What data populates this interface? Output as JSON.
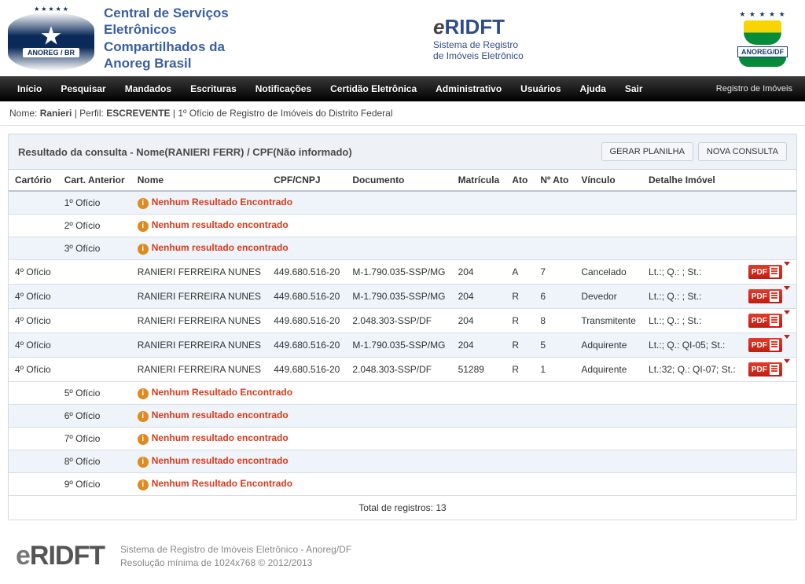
{
  "header": {
    "central_title_l1": "Central de Serviços",
    "central_title_l2": "Eletrônicos",
    "central_title_l3": "Compartilhados da",
    "central_title_l4": "Anoreg Brasil",
    "anoreg_br_band": "ANOREG / BR",
    "eridft_brand_e": "e",
    "eridft_brand_rest": "RIDFT",
    "eridft_sub1": "Sistema de Registro",
    "eridft_sub2": "de Imóveis Eletrônico",
    "anoreg_df_band": "ANOREG/DF"
  },
  "nav": {
    "inicio": "Início",
    "pesquisar": "Pesquisar",
    "mandados": "Mandados",
    "escrituras": "Escrituras",
    "notificacoes": "Notificações",
    "certidao": "Certidão Eletrônica",
    "administrativo": "Administrativo",
    "usuarios": "Usuários",
    "ajuda": "Ajuda",
    "sair": "Sair",
    "context": "Registro de Imóveis"
  },
  "userbar": {
    "nome_label": "Nome: ",
    "nome_value": "Ranieri",
    "sep1": "   |   ",
    "perfil_label": "Perfil: ",
    "perfil_value": "ESCREVENTE",
    "sep2": "   |   ",
    "oficio": "1º Ofício de Registro de Imóveis do Distrito Federal"
  },
  "result": {
    "title": "Resultado da consulta - Nome(RANIERI FERR) / CPF(Não informado)",
    "btn_planilha": "GERAR PLANILHA",
    "btn_nova": "NOVA CONSULTA"
  },
  "columns": {
    "cartorio": "Cartório",
    "cart_anterior": "Cart. Anterior",
    "nome": "Nome",
    "cpf": "CPF/CNPJ",
    "documento": "Documento",
    "matricula": "Matrícula",
    "ato": "Ato",
    "n_ato": "Nº Ato",
    "vinculo": "Vínculo",
    "detalhe": "Detalhe Imóvel",
    "acao": ""
  },
  "rows": [
    {
      "type": "empty",
      "cart_anterior": "1º Ofício",
      "msg": "Nenhum Resultado Encontrado"
    },
    {
      "type": "empty",
      "cart_anterior": "2º Ofício",
      "msg": "Nenhum resultado encontrado"
    },
    {
      "type": "empty",
      "cart_anterior": "3º Ofício",
      "msg": "Nenhum resultado encontrado"
    },
    {
      "type": "data",
      "cartorio": "4º Ofício",
      "nome": "RANIERI FERREIRA NUNES",
      "cpf": "449.680.516-20",
      "doc": "M-1.790.035-SSP/MG",
      "matricula": "204",
      "ato": "A",
      "n_ato": "7",
      "vinculo": "Cancelado",
      "detalhe": "Lt.:; Q.: ; St.:",
      "pdf": "PDF"
    },
    {
      "type": "data",
      "cartorio": "4º Ofício",
      "nome": "RANIERI FERREIRA NUNES",
      "cpf": "449.680.516-20",
      "doc": "M-1.790.035-SSP/MG",
      "matricula": "204",
      "ato": "R",
      "n_ato": "6",
      "vinculo": "Devedor",
      "detalhe": "Lt.:; Q.: ; St.:",
      "pdf": "PDF"
    },
    {
      "type": "data",
      "cartorio": "4º Ofício",
      "nome": "RANIERI FERREIRA NUNES",
      "cpf": "449.680.516-20",
      "doc": "2.048.303-SSP/DF",
      "matricula": "204",
      "ato": "R",
      "n_ato": "8",
      "vinculo": "Transmitente",
      "detalhe": "Lt.:; Q.: ; St.:",
      "pdf": "PDF"
    },
    {
      "type": "data",
      "cartorio": "4º Ofício",
      "nome": "RANIERI FERREIRA NUNES",
      "cpf": "449.680.516-20",
      "doc": "M-1.790.035-SSP/MG",
      "matricula": "204",
      "ato": "R",
      "n_ato": "5",
      "vinculo": "Adquirente",
      "detalhe": "Lt.:; Q.: QI-05; St.:",
      "pdf": "PDF"
    },
    {
      "type": "data",
      "cartorio": "4º Ofício",
      "nome": "RANIERI FERREIRA NUNES",
      "cpf": "449.680.516-20",
      "doc": "2.048.303-SSP/DF",
      "matricula": "51289",
      "ato": "R",
      "n_ato": "1",
      "vinculo": "Adquirente",
      "detalhe": "Lt.:32; Q.: QI-07; St.:",
      "pdf": "PDF"
    },
    {
      "type": "empty",
      "cart_anterior": "5º Ofício",
      "msg": "Nenhum Resultado Encontrado"
    },
    {
      "type": "empty",
      "cart_anterior": "6º Ofício",
      "msg": "Nenhum resultado encontrado"
    },
    {
      "type": "empty",
      "cart_anterior": "7º Ofício",
      "msg": "Nenhum resultado encontrado"
    },
    {
      "type": "empty",
      "cart_anterior": "8º Ofício",
      "msg": "Nenhum resultado encontrado"
    },
    {
      "type": "empty",
      "cart_anterior": "9º Ofício",
      "msg": "Nenhum Resultado Encontrado"
    }
  ],
  "total_label": "Total de registros: 13",
  "footer": {
    "logo_e": "e",
    "logo_rest": "RIDFT",
    "line1": "Sistema de Registro de Imóveis Eletrônico - Anoreg/DF",
    "line2": "Resolução mínima de 1024x768 © 2012/2013"
  }
}
